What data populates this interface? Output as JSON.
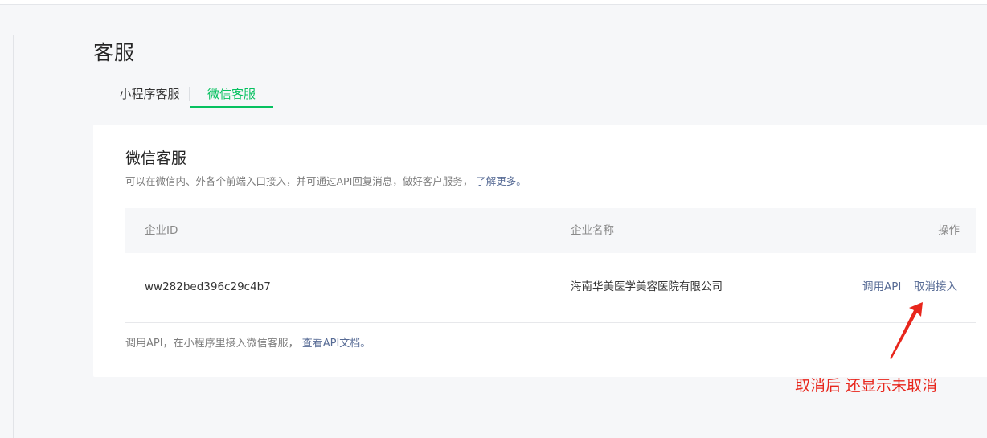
{
  "page": {
    "title": "客服"
  },
  "tabs": [
    {
      "label": "小程序客服",
      "active": false
    },
    {
      "label": "微信客服",
      "active": true
    }
  ],
  "card": {
    "title": "微信客服",
    "desc": "可以在微信内、外各个前端入口接入，并可通过API回复消息，做好客户服务，",
    "desc_link": "了解更多。",
    "table": {
      "headers": {
        "id": "企业ID",
        "name": "企业名称",
        "op": "操作"
      },
      "rows": [
        {
          "id": "ww282bed396c29c4b7",
          "name": "海南华美医学美容医院有限公司",
          "actions": {
            "api": "调用API",
            "cancel": "取消接入"
          }
        }
      ]
    },
    "footer": "调用API，在小程序里接入微信客服，",
    "footer_link": "查看API文档。"
  },
  "annotation": {
    "text": "取消后 还显示未取消",
    "color": "#e8261c"
  },
  "colors": {
    "accent": "#07c160",
    "link": "#576b95"
  }
}
